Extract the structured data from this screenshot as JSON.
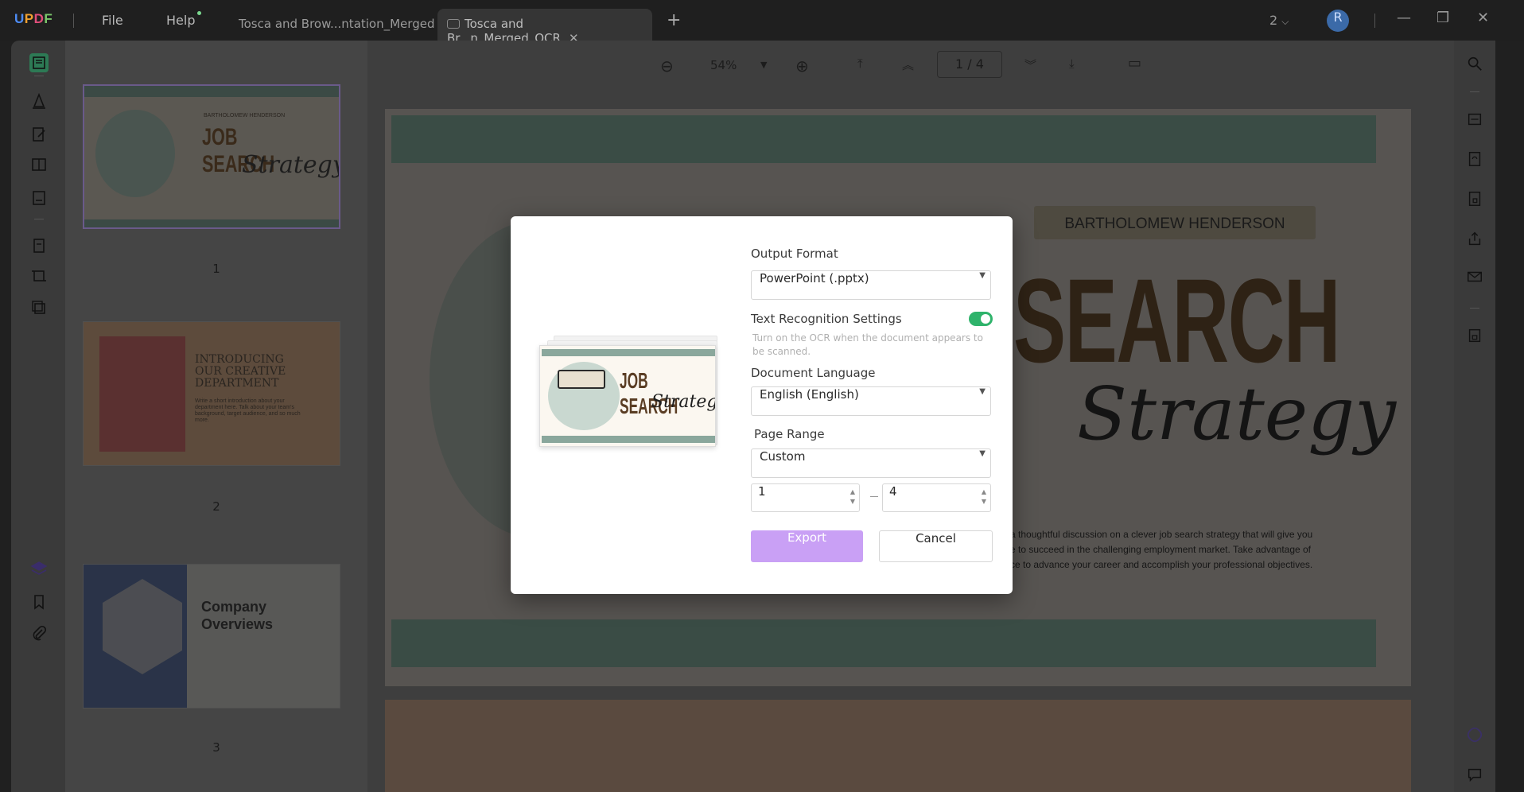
{
  "app": {
    "logo": "UPDF",
    "menu": {
      "file": "File",
      "help": "Help"
    },
    "tabs": [
      {
        "label": "Tosca and Brow...ntation_Merged"
      },
      {
        "label": "Tosca and Br...n_Merged_OCR"
      }
    ],
    "window_count": "2",
    "avatar_initial": "R"
  },
  "toolbar": {
    "zoom": "54%",
    "page_current": "1",
    "page_total": "4",
    "page_display": "1  /  4"
  },
  "thumbnails": [
    {
      "number": "1",
      "title": "JOB SEARCH",
      "subtitle": "Strategy",
      "name": "BARTHOLOMEW HENDERSON"
    },
    {
      "number": "2",
      "title": "INTRODUCING OUR CREATIVE DEPARTMENT",
      "body": "Write a short introduction about your department here. Talk about your team's background, target audience, and so much more."
    },
    {
      "number": "3",
      "title": "Company Overviews"
    }
  ],
  "document": {
    "name": "BARTHOLOMEW HENDERSON",
    "headline": "SEARCH",
    "script": "Strategy",
    "body_lines": [
      "a thoughtful discussion on a clever job search strategy that will give you",
      "e to succeed in the challenging employment market. Take advantage of",
      "ce to advance your career and accomplish your professional objectives."
    ]
  },
  "dialog": {
    "output_format_label": "Output Format",
    "output_format_value": "PowerPoint (.pptx)",
    "ocr_label": "Text Recognition Settings",
    "ocr_enabled": true,
    "ocr_hint": "Turn on the OCR when the document appears to be scanned.",
    "language_label": "Document Language",
    "language_value": "English (English)",
    "page_range_label": "Page Range",
    "page_range_value": "Custom",
    "range_from": "1",
    "range_to": "4",
    "export_label": "Export",
    "cancel_label": "Cancel",
    "preview_title": "JOB SEARCH",
    "preview_subtitle": "Strategy"
  },
  "colors": {
    "export_button": "#c9a0f5",
    "toggle_on": "#2fb36b",
    "avatar": "#3b6aa8"
  }
}
